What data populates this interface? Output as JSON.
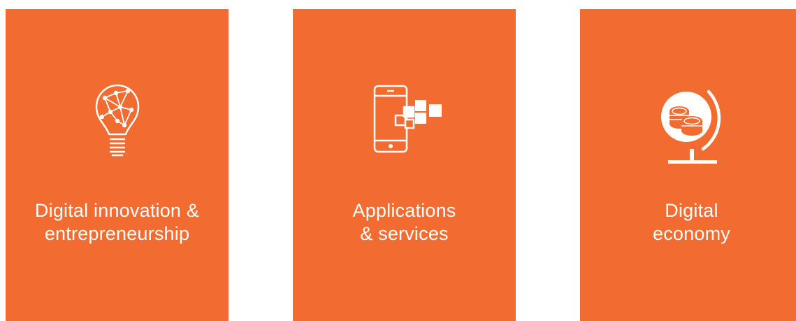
{
  "theme": {
    "card_color": "#f26b30",
    "text_color": "#ffffff"
  },
  "cards": [
    {
      "icon": "lightbulb-network-icon",
      "line1": "Digital innovation &",
      "line2": "entrepreneurship"
    },
    {
      "icon": "smartphone-apps-icon",
      "line1": "Applications",
      "line2": "& services"
    },
    {
      "icon": "globe-coins-icon",
      "line1": "Digital",
      "line2": "economy"
    }
  ]
}
